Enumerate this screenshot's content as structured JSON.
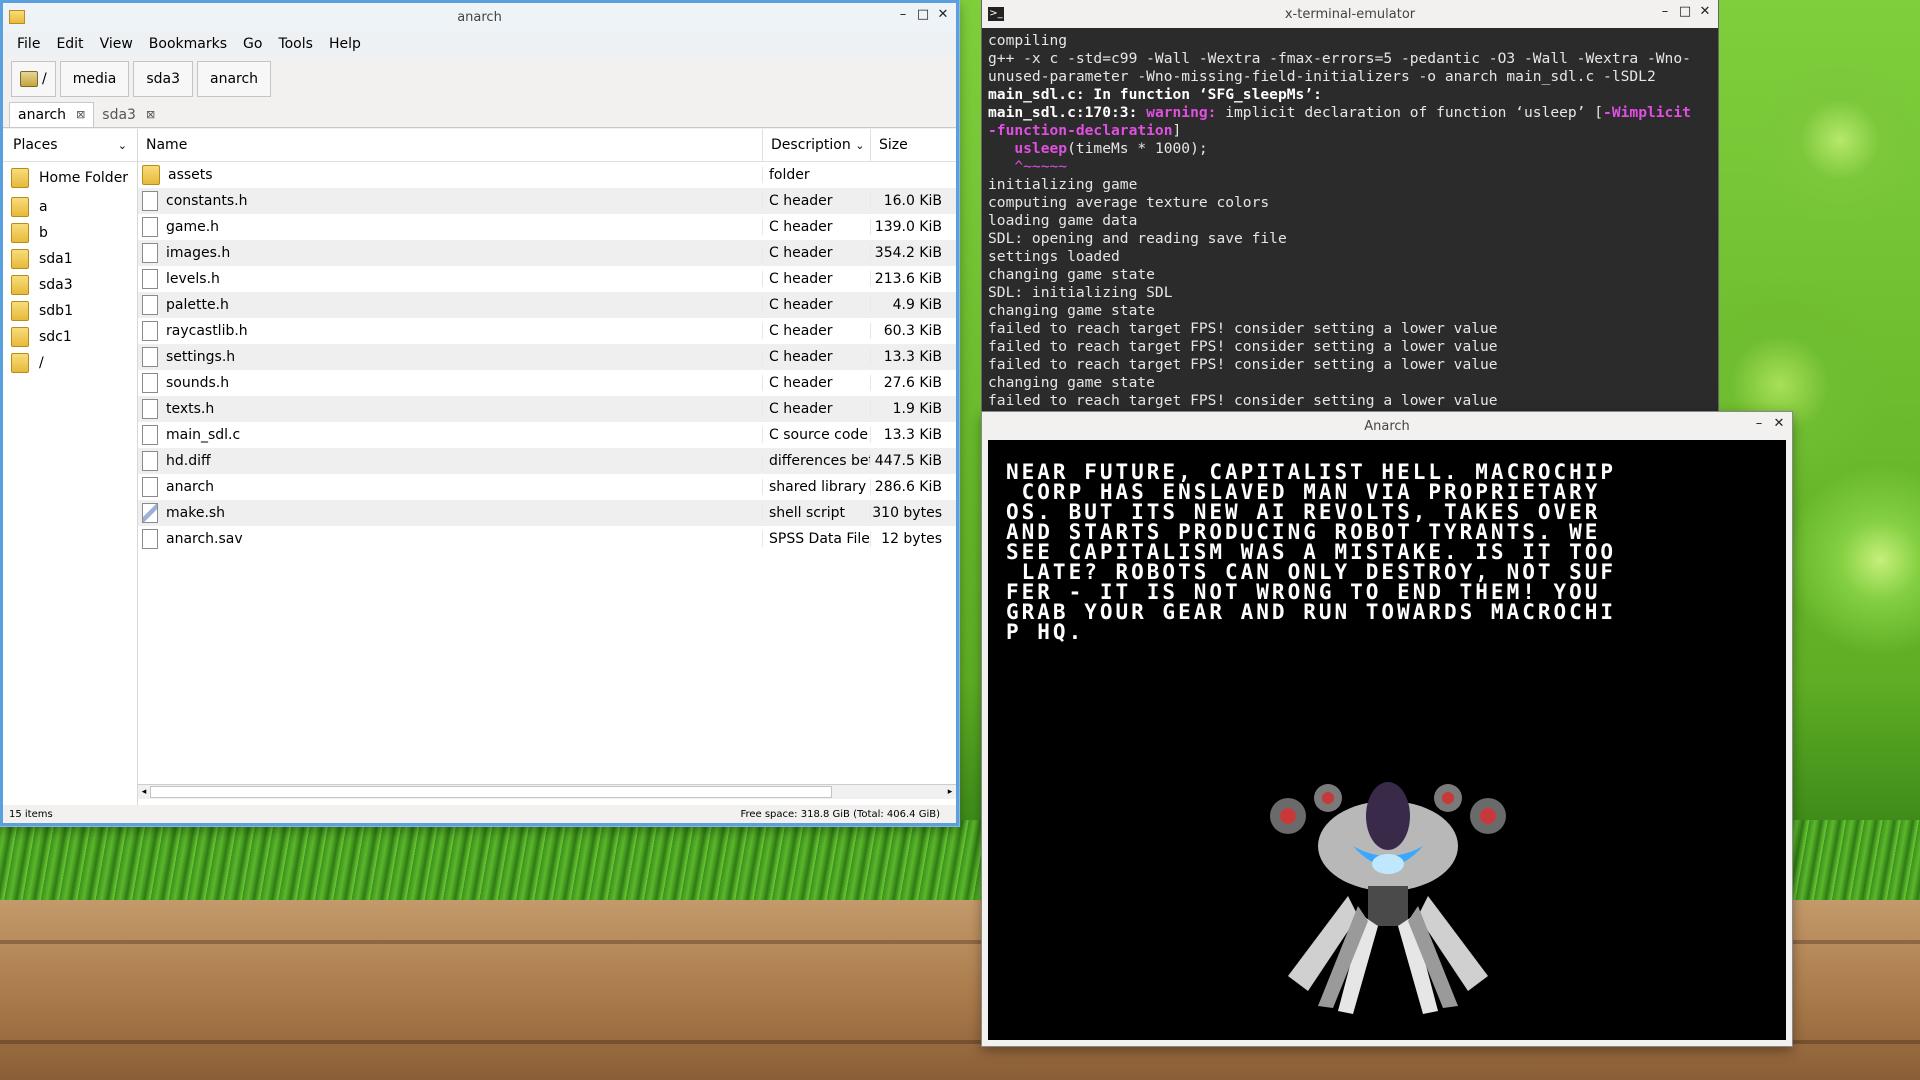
{
  "file_manager": {
    "title": "anarch",
    "menu": [
      "File",
      "Edit",
      "View",
      "Bookmarks",
      "Go",
      "Tools",
      "Help"
    ],
    "path": [
      "/",
      "media",
      "sda3",
      "anarch"
    ],
    "tabs": [
      {
        "label": "anarch"
      },
      {
        "label": "sda3"
      }
    ],
    "places_header": "Places",
    "places": [
      "Home Folder",
      "a",
      "b",
      "sda1",
      "sda3",
      "sdb1",
      "sdc1",
      "/"
    ],
    "columns": {
      "name": "Name",
      "description": "Description",
      "size": "Size"
    },
    "files": [
      {
        "name": "assets",
        "desc": "folder",
        "size": "",
        "icon": "folder-icon"
      },
      {
        "name": "constants.h",
        "desc": "C header",
        "size": "16.0 KiB",
        "icon": "file-icon"
      },
      {
        "name": "game.h",
        "desc": "C header",
        "size": "139.0 KiB",
        "icon": "file-icon"
      },
      {
        "name": "images.h",
        "desc": "C header",
        "size": "354.2 KiB",
        "icon": "file-icon"
      },
      {
        "name": "levels.h",
        "desc": "C header",
        "size": "213.6 KiB",
        "icon": "file-icon"
      },
      {
        "name": "palette.h",
        "desc": "C header",
        "size": "4.9 KiB",
        "icon": "file-icon"
      },
      {
        "name": "raycastlib.h",
        "desc": "C header",
        "size": "60.3 KiB",
        "icon": "file-icon"
      },
      {
        "name": "settings.h",
        "desc": "C header",
        "size": "13.3 KiB",
        "icon": "file-icon"
      },
      {
        "name": "sounds.h",
        "desc": "C header",
        "size": "27.6 KiB",
        "icon": "file-icon"
      },
      {
        "name": "texts.h",
        "desc": "C header",
        "size": "1.9 KiB",
        "icon": "file-icon"
      },
      {
        "name": "main_sdl.c",
        "desc": "C source code",
        "size": "13.3 KiB",
        "icon": "file-icon"
      },
      {
        "name": "hd.diff",
        "desc": "differences betw",
        "size": "447.5 KiB",
        "icon": "file-icon"
      },
      {
        "name": "anarch",
        "desc": "shared library",
        "size": "286.6 KiB",
        "icon": "file-icon"
      },
      {
        "name": "make.sh",
        "desc": "shell script",
        "size": "310 bytes",
        "icon": "script-icon"
      },
      {
        "name": "anarch.sav",
        "desc": "SPSS Data File",
        "size": "12 bytes",
        "icon": "file-icon"
      }
    ],
    "status_left": "15 items",
    "status_right": "Free space: 318.8 GiB (Total: 406.4 GiB)"
  },
  "terminal": {
    "title": "x-terminal-emulator",
    "lines": [
      {
        "t": "compiling"
      },
      {
        "t": "g++ -x c -std=c99 -Wall -Wextra -fmax-errors=5 -pedantic -O3 -Wall -Wextra -Wno-"
      },
      {
        "t": "unused-parameter -Wno-missing-field-initializers -o anarch main_sdl.c -lSDL2"
      },
      {
        "t": "main_sdl.c: In function ‘SFG_sleepMs’:",
        "style": "bold"
      },
      {
        "t": "main_sdl.c:170:3: warning: implicit declaration of function ‘usleep’ [-Wimplicit",
        "style": "warn"
      },
      {
        "t": "-function-declaration]",
        "style": "magenta-tail"
      },
      {
        "t": "   usleep(timeMs * 1000);",
        "style": "usleep"
      },
      {
        "t": "   ^~~~~~",
        "style": "magenta"
      },
      {
        "t": "initializing game"
      },
      {
        "t": "computing average texture colors"
      },
      {
        "t": "loading game data"
      },
      {
        "t": "SDL: opening and reading save file"
      },
      {
        "t": "settings loaded"
      },
      {
        "t": "changing game state"
      },
      {
        "t": "SDL: initializing SDL"
      },
      {
        "t": "changing game state"
      },
      {
        "t": "failed to reach target FPS! consider setting a lower value"
      },
      {
        "t": "failed to reach target FPS! consider setting a lower value"
      },
      {
        "t": "failed to reach target FPS! consider setting a lower value"
      },
      {
        "t": "changing game state"
      },
      {
        "t": "failed to reach target FPS! consider setting a lower value"
      }
    ]
  },
  "game": {
    "title": "Anarch",
    "story": "NEAR FUTURE, CAPITALIST HELL. MACROCHIP\n CORP HAS ENSLAVED MAN VIA PROPRIETARY\nOS. BUT ITS NEW AI REVOLTS, TAKES OVER\nAND STARTS PRODUCING ROBOT TYRANTS. WE\nSEE CAPITALISM WAS A MISTAKE. IS IT TOO\n LATE? ROBOTS CAN ONLY DESTROY, NOT SUF\nFER - IT IS NOT WRONG TO END THEM! YOU\nGRAB YOUR GEAR AND RUN TOWARDS MACROCHI\nP HQ."
  }
}
